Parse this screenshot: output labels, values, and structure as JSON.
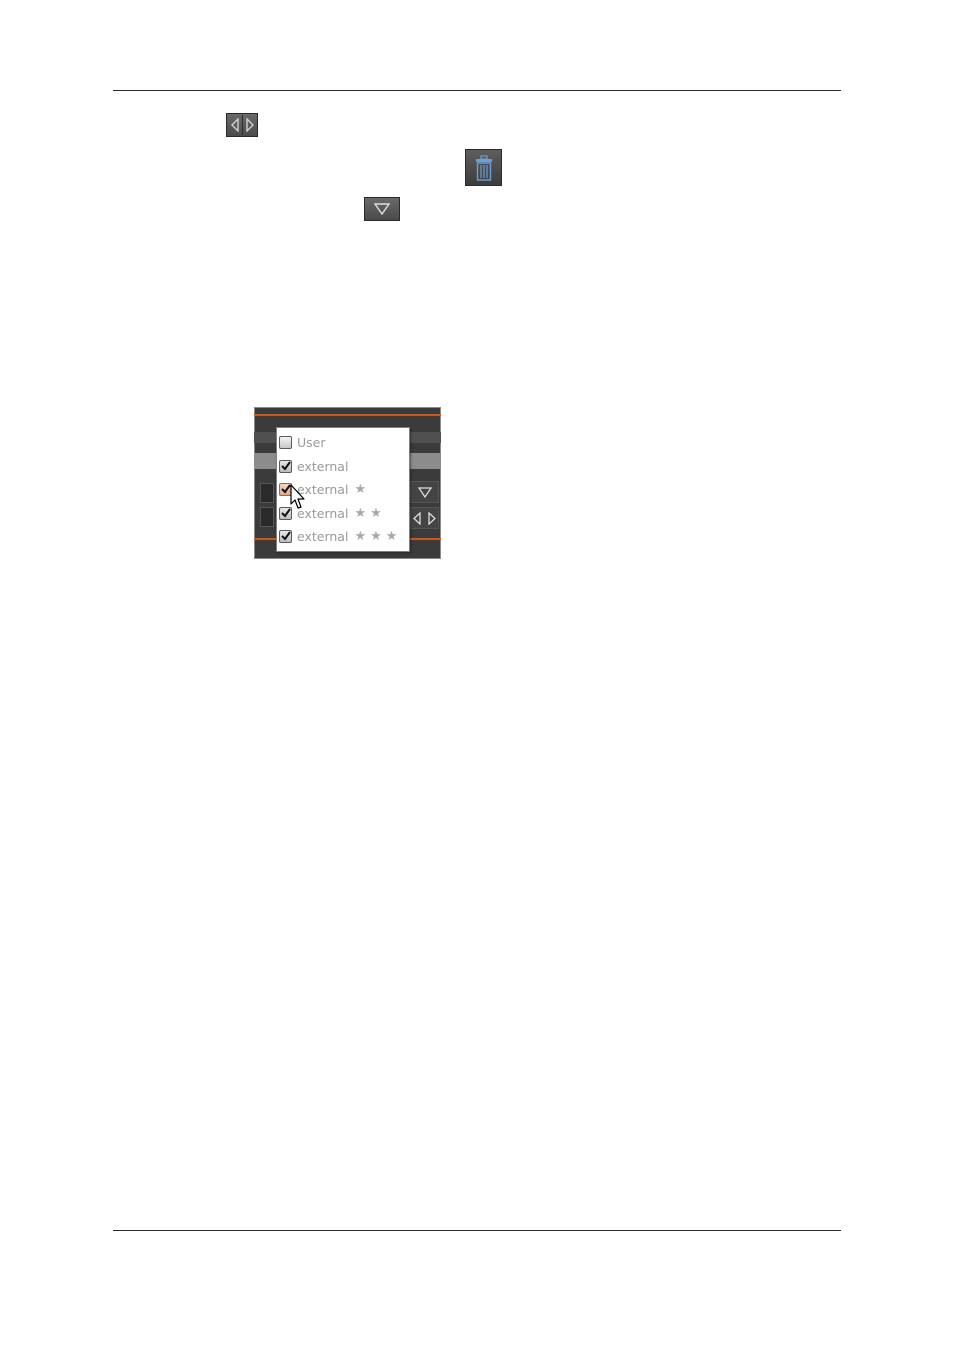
{
  "page": {
    "toolbar_icons": [
      {
        "name": "nav-left-right-icon"
      },
      {
        "name": "trash-icon"
      },
      {
        "name": "filter-dropdown-icon"
      }
    ]
  },
  "filter_menu": {
    "items": [
      {
        "label": "User",
        "checked": false,
        "stars": ""
      },
      {
        "label": "external",
        "checked": true,
        "stars": ""
      },
      {
        "label": "external",
        "checked": true,
        "stars": "★"
      },
      {
        "label": "external",
        "checked": true,
        "stars": "★★"
      },
      {
        "label": "external",
        "checked": true,
        "stars": "★★★"
      }
    ]
  },
  "colors": {
    "accent": "#c85a1e",
    "panel_bg": "#3b3b3b",
    "trash_blue": "#6aa0d8"
  }
}
